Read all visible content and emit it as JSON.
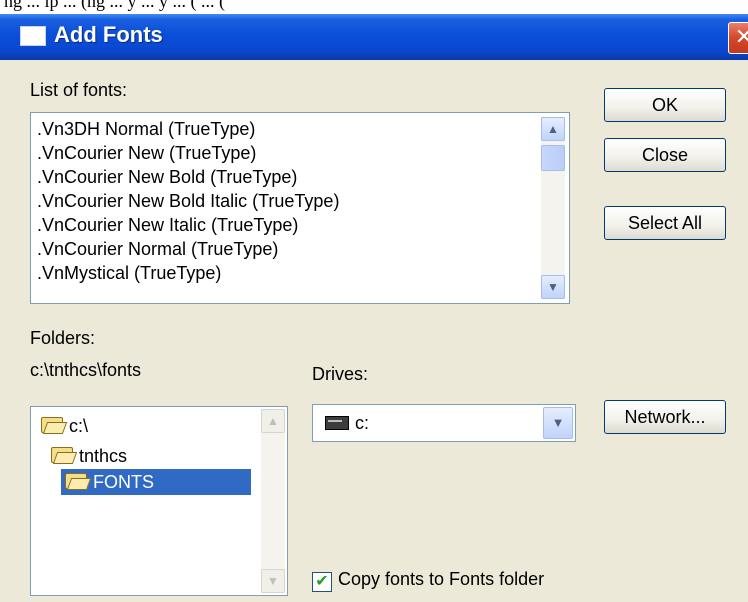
{
  "page_fragment": "ng ... lp ... (ng ... y ... y ... ( ... (",
  "window": {
    "title": "Add Fonts",
    "close_glyph": "✕"
  },
  "fonts": {
    "label": "List of fonts:",
    "items": [
      ".Vn3DH Normal (TrueType)",
      ".VnCourier New (TrueType)",
      ".VnCourier New Bold (TrueType)",
      ".VnCourier New Bold Italic (TrueType)",
      ".VnCourier New Italic (TrueType)",
      ".VnCourier Normal (TrueType)",
      ".VnMystical (TrueType)"
    ]
  },
  "buttons": {
    "ok": "OK",
    "close": "Close",
    "select_all": "Select All",
    "network": "Network..."
  },
  "folders": {
    "label": "Folders:",
    "current_path": "c:\\tnthcs\\fonts",
    "items": [
      {
        "name": "c:\\",
        "level": 0,
        "icon": "folder-open-icon"
      },
      {
        "name": "tnthcs",
        "level": 1,
        "icon": "folder-open-icon"
      },
      {
        "name": "FONTS",
        "level": 2,
        "icon": "folder-open-icon",
        "selected": true
      }
    ]
  },
  "drives": {
    "label": "Drives:",
    "selected": "c:",
    "icon": "drive-icon"
  },
  "copy_option": {
    "label": "Copy fonts to Fonts folder",
    "checked": true
  },
  "colors": {
    "title_bar": "#0a4fd8",
    "dialog_bg": "#ece9d8",
    "selection": "#316ac5"
  }
}
